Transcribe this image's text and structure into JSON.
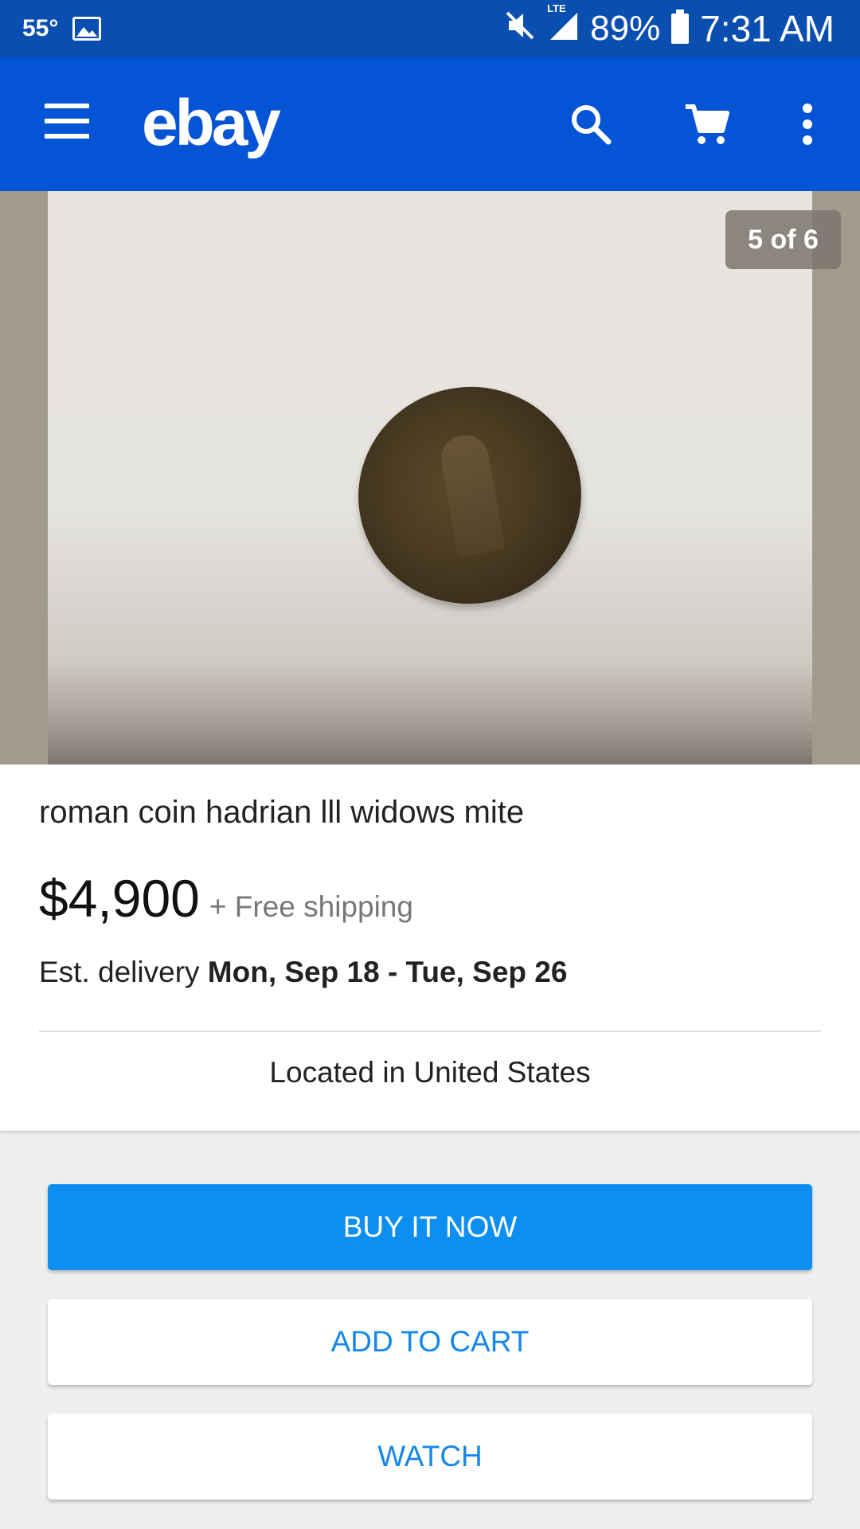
{
  "status_bar": {
    "temperature": "55°",
    "battery_percent": "89%",
    "time": "7:31 AM",
    "network_label": "LTE",
    "icons": [
      "image-icon",
      "mute-icon",
      "signal-icon",
      "battery-icon"
    ]
  },
  "app_bar": {
    "logo": "ebay",
    "icons": [
      "menu-icon",
      "search-icon",
      "cart-icon",
      "overflow-menu-icon"
    ],
    "color": "#0654d6"
  },
  "gallery": {
    "counter": "5 of 6",
    "current_index": 5,
    "total": 6
  },
  "listing": {
    "title": "roman coin hadrian lll widows mite",
    "price": "$4,900",
    "shipping": "+ Free shipping",
    "delivery_prefix": "Est. delivery",
    "delivery_dates": "Mon, Sep 18 - Tue, Sep 26",
    "location": "Located in United States"
  },
  "actions": {
    "buy_now": "BUY IT NOW",
    "add_to_cart": "ADD TO CART",
    "watch": "WATCH",
    "primary_color": "#0c8ff0",
    "secondary_text_color": "#1687e8"
  }
}
